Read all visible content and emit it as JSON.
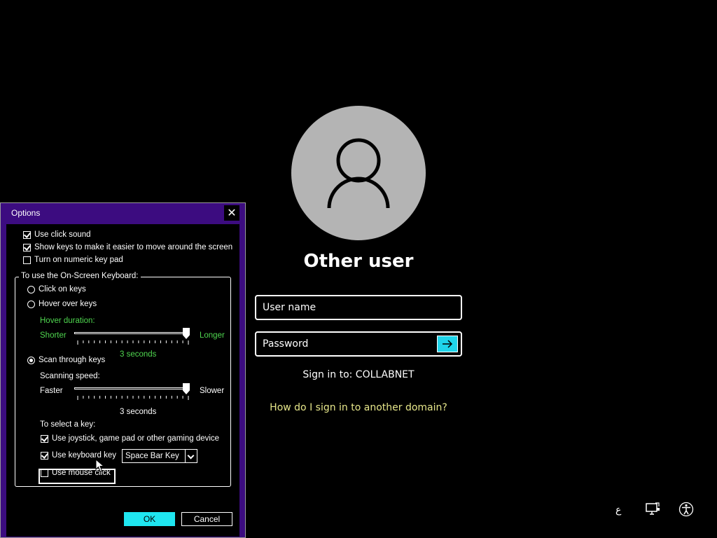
{
  "login": {
    "title": "Other user",
    "username_placeholder": "User name",
    "password_placeholder": "Password",
    "sign_in_to": "Sign in to: COLLABNET",
    "other_domain_link": "How do I sign in to another domain?"
  },
  "tray": {
    "language": "ع",
    "icons": [
      "network-icon",
      "accessibility-icon"
    ]
  },
  "dialog": {
    "title": "Options",
    "close": "✕",
    "options": {
      "click_sound": {
        "label": "Use click sound",
        "checked": true
      },
      "show_keys": {
        "label": "Show keys to make it easier to move around the screen",
        "checked": true
      },
      "numeric_pad": {
        "label": "Turn on numeric key pad",
        "checked": false
      }
    },
    "group_title": "To use the On-Screen Keyboard:",
    "click_on_keys": "Click on keys",
    "hover_over_keys": "Hover over keys",
    "hover_duration": {
      "label": "Hover duration:",
      "min_label": "Shorter",
      "max_label": "Longer",
      "value_text": "3 seconds",
      "level": 1.0
    },
    "scan_through_keys": "Scan through keys",
    "scanning_speed": {
      "label": "Scanning speed:",
      "min_label": "Faster",
      "max_label": "Slower",
      "value_text": "3 seconds",
      "level": 1.0
    },
    "select_key_label": "To select a key:",
    "use_joystick": {
      "label": "Use joystick, game pad or other gaming device",
      "checked": true
    },
    "use_keyboard_key": {
      "label": "Use keyboard key",
      "checked": true
    },
    "keyboard_key_combo": "Space Bar Key",
    "use_mouse_click": {
      "label": "Use mouse click",
      "checked": false
    },
    "ok": "OK",
    "cancel": "Cancel",
    "selected_mode": "Scan through keys"
  },
  "colors": {
    "dialog_frame": "#3c0c80",
    "accent": "#1fe6f0",
    "disabled_green": "#4fd64f",
    "link": "#e6e68a",
    "avatar_bg": "#b4b4b4"
  }
}
